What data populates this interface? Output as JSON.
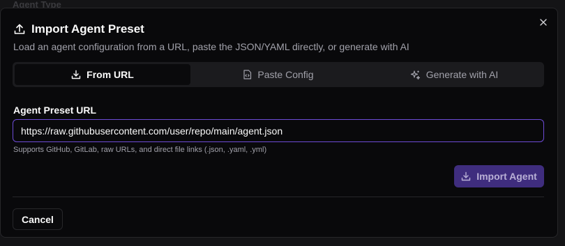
{
  "background": {
    "label": "Agent Type"
  },
  "dialog": {
    "title": "Import Agent Preset",
    "description": "Load an agent configuration from a URL, paste the JSON/YAML directly, or generate with AI",
    "close_icon": "close-icon",
    "title_icon": "upload-icon"
  },
  "tabs": [
    {
      "label": "From URL",
      "icon": "download-icon",
      "active": true
    },
    {
      "label": "Paste Config",
      "icon": "file-code-icon",
      "active": false
    },
    {
      "label": "Generate with AI",
      "icon": "sparkles-icon",
      "active": false
    }
  ],
  "url_field": {
    "label": "Agent Preset URL",
    "value": "https://raw.githubusercontent.com/user/repo/main/agent.json",
    "hint": "Supports GitHub, GitLab, raw URLs, and direct file links (.json, .yaml, .yml)"
  },
  "actions": {
    "import_label": "Import Agent",
    "cancel_label": "Cancel"
  },
  "colors": {
    "accent_border": "#6d4bd6",
    "import_button": "#3f2d7e",
    "background": "#09090b"
  }
}
